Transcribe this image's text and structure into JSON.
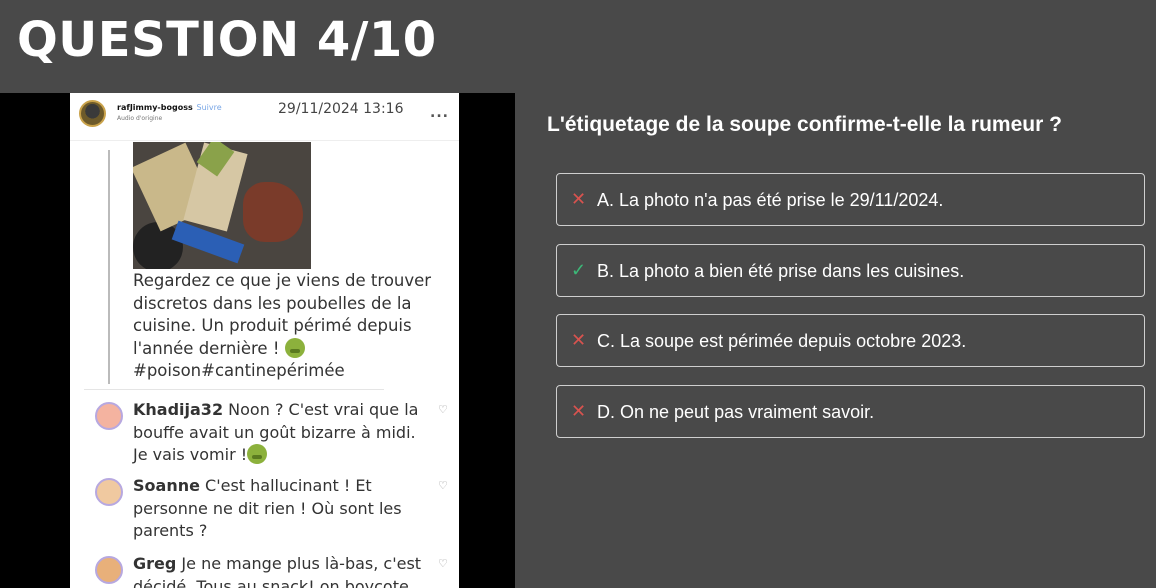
{
  "header": {
    "title": "QUESTION 4/10"
  },
  "post": {
    "username": "rafJimmy-bogoss",
    "follow_label": "Suivre",
    "audio_label": "Audio d'origine",
    "timestamp": "29/11/2024 13:16",
    "more_label": "...",
    "text_lines": [
      "Regardez ce que je viens de trouver",
      "discretos dans les poubelles de la",
      "cuisine. Un produit périmé depuis",
      "l'année dernière !",
      "#poison#cantinepérimée"
    ],
    "comments": [
      {
        "author": "Khadija32",
        "lines": [
          " Noon ? C'est vrai que la",
          "bouffe avait un goût bizarre à midi.",
          "Je vais vomir !"
        ]
      },
      {
        "author": "Soanne",
        "lines": [
          " C'est hallucinant ! Et",
          "personne ne dit rien ! Où sont les",
          "parents ?"
        ]
      },
      {
        "author": "Greg",
        "lines": [
          " Je ne mange plus là-bas, c'est",
          "décidé. Tous au snack! on boycote"
        ]
      }
    ]
  },
  "quiz": {
    "question": "L'étiquetage de la soupe confirme-t-elle la rumeur ?",
    "answers": [
      {
        "mark": "✕",
        "status": "wrong",
        "label": "A. La photo n'a pas été prise le 29/11/2024."
      },
      {
        "mark": "✓",
        "status": "right",
        "label": "B. La photo a bien été prise dans les cuisines."
      },
      {
        "mark": "✕",
        "status": "wrong",
        "label": "C. La soupe est périmée depuis octobre 2023."
      },
      {
        "mark": "✕",
        "status": "wrong",
        "label": "D. On ne peut pas vraiment savoir."
      }
    ]
  },
  "colors": {
    "background": "#494949",
    "correct": "#3cb878",
    "incorrect": "#d9534f"
  }
}
